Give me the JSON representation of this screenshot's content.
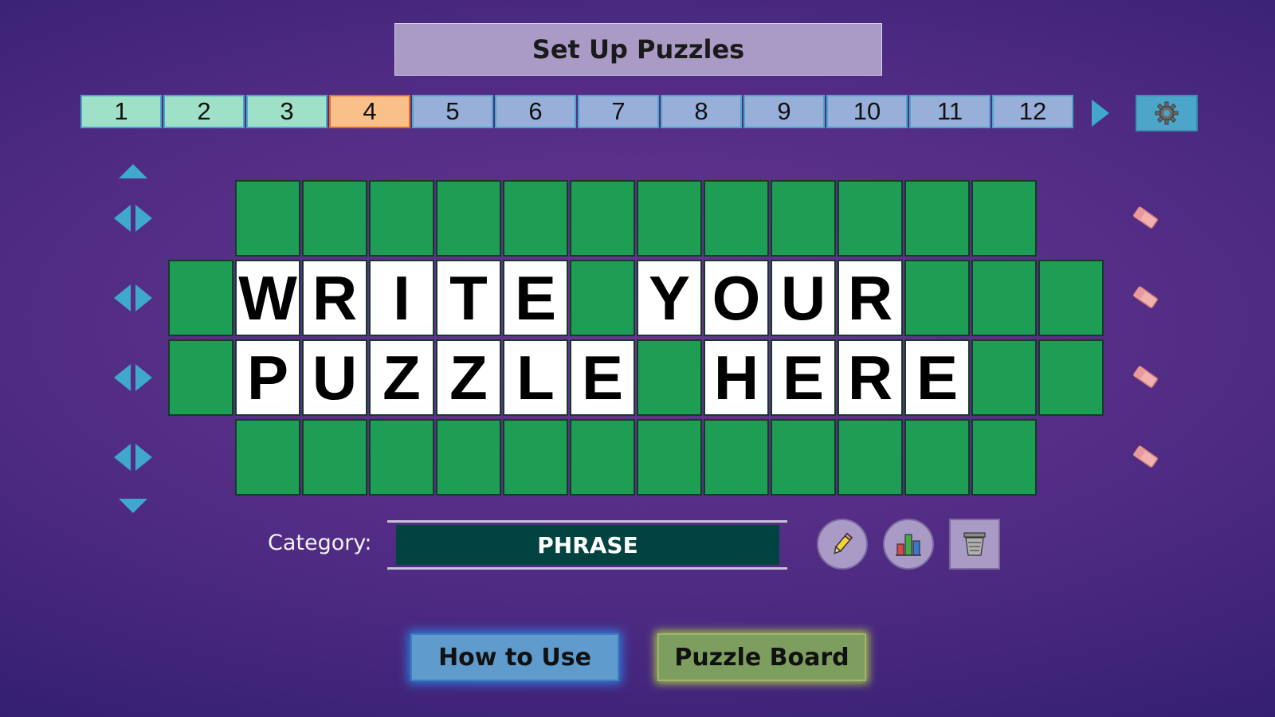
{
  "title": "Set Up Puzzles",
  "tabs": [
    {
      "label": "1",
      "state": "done"
    },
    {
      "label": "2",
      "state": "done"
    },
    {
      "label": "3",
      "state": "done"
    },
    {
      "label": "4",
      "state": "active"
    },
    {
      "label": "5",
      "state": "todo"
    },
    {
      "label": "6",
      "state": "todo"
    },
    {
      "label": "7",
      "state": "todo"
    },
    {
      "label": "8",
      "state": "todo"
    },
    {
      "label": "9",
      "state": "todo"
    },
    {
      "label": "10",
      "state": "todo"
    },
    {
      "label": "11",
      "state": "todo"
    },
    {
      "label": "12",
      "state": "todo"
    }
  ],
  "icons": {
    "next": "next-arrow-icon",
    "settings": "gear-icon",
    "scroll_up": "triangle-up-icon",
    "scroll_down": "triangle-down-icon",
    "row_shift": "left-right-arrows-icon",
    "row_clear": "eraser-icon",
    "edit": "pencil-icon",
    "stats": "bar-chart-icon",
    "delete": "trash-icon"
  },
  "board": {
    "rows": [
      {
        "cells": [
          "",
          "",
          "",
          "",
          "",
          "",
          "",
          "",
          "",
          "",
          "",
          ""
        ]
      },
      {
        "cells": [
          "",
          "W",
          "R",
          "I",
          "T",
          "E",
          "",
          "Y",
          "O",
          "U",
          "R",
          "",
          "",
          ""
        ]
      },
      {
        "cells": [
          "",
          "P",
          "U",
          "Z",
          "Z",
          "L",
          "E",
          "",
          "H",
          "E",
          "R",
          "E",
          "",
          ""
        ]
      },
      {
        "cells": [
          "",
          "",
          "",
          "",
          "",
          "",
          "",
          "",
          "",
          "",
          "",
          ""
        ]
      }
    ]
  },
  "category": {
    "label": "Category:",
    "value": "PHRASE"
  },
  "buttons": {
    "how_to_use": "How to Use",
    "puzzle_board": "Puzzle Board"
  },
  "colors": {
    "tab_done": "#9ee0c8",
    "tab_active": "#f9c08a",
    "tab_todo": "#98afd9",
    "tile_empty": "#1e9e55",
    "tile_letter": "#ffffff",
    "accent": "#3fa8cc",
    "category_bg": "#004340"
  }
}
